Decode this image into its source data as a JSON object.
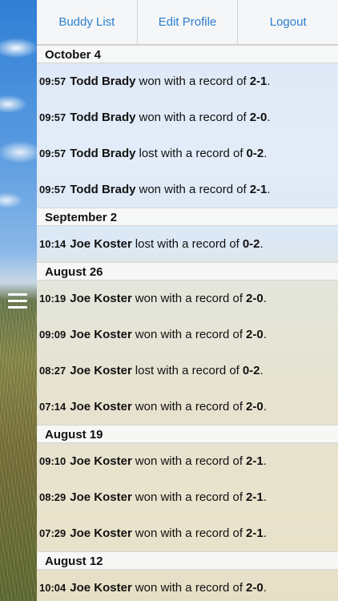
{
  "nav": {
    "buddy_list": "Buddy List",
    "edit_profile": "Edit Profile",
    "logout": "Logout"
  },
  "sections": [
    {
      "date": "October 4",
      "rows": [
        {
          "time": "09:57",
          "name": "Todd Brady",
          "result": "won with a record of",
          "record": "2-1",
          "dot": "."
        },
        {
          "time": "09:57",
          "name": "Todd Brady",
          "result": "won with a record of",
          "record": "2-0",
          "dot": "."
        },
        {
          "time": "09:57",
          "name": "Todd Brady",
          "result": "lost with a record of",
          "record": "0-2",
          "dot": "."
        },
        {
          "time": "09:57",
          "name": "Todd Brady",
          "result": "won with a record of",
          "record": "2-1",
          "dot": "."
        }
      ]
    },
    {
      "date": "September 2",
      "rows": [
        {
          "time": "10:14",
          "name": "Joe Koster",
          "result": "lost with a record of",
          "record": "0-2",
          "dot": "."
        }
      ]
    },
    {
      "date": "August 26",
      "rows": [
        {
          "time": "10:19",
          "name": "Joe Koster",
          "result": "won with a record of",
          "record": "2-0",
          "dot": "."
        },
        {
          "time": "09:09",
          "name": "Joe Koster",
          "result": "won with a record of",
          "record": "2-0",
          "dot": "."
        },
        {
          "time": "08:27",
          "name": "Joe Koster",
          "result": "lost with a record of",
          "record": "0-2",
          "dot": "."
        },
        {
          "time": "07:14",
          "name": "Joe Koster",
          "result": "won with a record of",
          "record": "2-0",
          "dot": "."
        }
      ]
    },
    {
      "date": "August 19",
      "rows": [
        {
          "time": "09:10",
          "name": "Joe Koster",
          "result": "won with a record of",
          "record": "2-1",
          "dot": "."
        },
        {
          "time": "08:29",
          "name": "Joe Koster",
          "result": "won with a record of",
          "record": "2-1",
          "dot": "."
        },
        {
          "time": "07:29",
          "name": "Joe Koster",
          "result": "won with a record of",
          "record": "2-1",
          "dot": "."
        }
      ]
    },
    {
      "date": "August 12",
      "rows": [
        {
          "time": "10:04",
          "name": "Joe Koster",
          "result": "won with a record of",
          "record": "2-0",
          "dot": "."
        }
      ]
    }
  ],
  "colors": {
    "accent": "#2c7fd0",
    "text": "#111111"
  },
  "icons": {
    "menu": "hamburger-menu-icon"
  }
}
